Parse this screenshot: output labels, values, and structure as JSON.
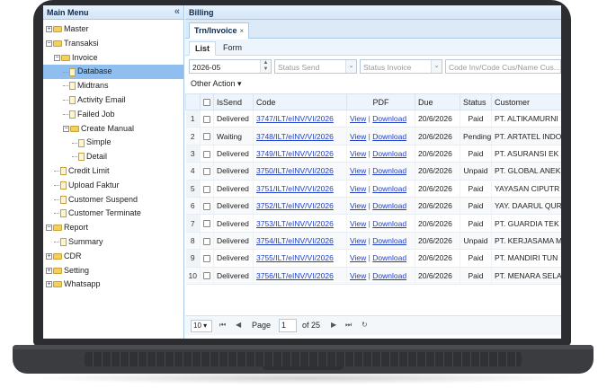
{
  "sidebar": {
    "title": "Main Menu",
    "collapse_icon": "«",
    "items": [
      {
        "label": "Master"
      },
      {
        "label": "Transaksi"
      },
      {
        "label": "Invoice"
      },
      {
        "label": "Database"
      },
      {
        "label": "Midtrans"
      },
      {
        "label": "Activity Email"
      },
      {
        "label": "Failed Job"
      },
      {
        "label": "Create Manual"
      },
      {
        "label": "Simple"
      },
      {
        "label": "Detail"
      },
      {
        "label": "Credit Limit"
      },
      {
        "label": "Upload Faktur"
      },
      {
        "label": "Customer Suspend"
      },
      {
        "label": "Customer Terminate"
      },
      {
        "label": "Report"
      },
      {
        "label": "Summary"
      },
      {
        "label": "CDR"
      },
      {
        "label": "Setting"
      },
      {
        "label": "Whatsapp"
      }
    ]
  },
  "main": {
    "title": "Billing",
    "tab_label": "Trn/Invoice",
    "tab_close": "×",
    "subtabs": [
      "List",
      "Form"
    ],
    "filters": {
      "period": "2026-05",
      "status_send_placeholder": "Status Send",
      "status_invoice_placeholder": "Status Invoice",
      "search_placeholder": "Code Inv/Code Cus/Name Cus..."
    },
    "other_action": "Other Action",
    "columns": [
      "IsSend",
      "Code",
      "PDF",
      "Due",
      "Status",
      "Customer"
    ],
    "pdf_view": "View",
    "pdf_download": "Download",
    "rows": [
      {
        "n": "1",
        "issend": "Delivered",
        "code": "3747/ILT/eINV/VI/2026",
        "due": "20/6/2026",
        "status": "Paid",
        "customer": "PT. ALTIKAMURNI"
      },
      {
        "n": "2",
        "issend": "Waiting",
        "code": "3748/ILT/eINV/VI/2026",
        "due": "20/6/2026",
        "status": "Pending",
        "customer": "PT. ARTATEL INDO"
      },
      {
        "n": "3",
        "issend": "Delivered",
        "code": "3749/ILT/eINV/VI/2026",
        "due": "20/6/2026",
        "status": "Paid",
        "customer": "PT. ASURANSI EK"
      },
      {
        "n": "4",
        "issend": "Delivered",
        "code": "3750/ILT/eINV/VI/2026",
        "due": "20/6/2026",
        "status": "Unpaid",
        "customer": "PT. GLOBAL ANEK"
      },
      {
        "n": "5",
        "issend": "Delivered",
        "code": "3751/ILT/eINV/VI/2026",
        "due": "20/6/2026",
        "status": "Paid",
        "customer": "YAYASAN CIPUTR"
      },
      {
        "n": "6",
        "issend": "Delivered",
        "code": "3752/ILT/eINV/VI/2026",
        "due": "20/6/2026",
        "status": "Paid",
        "customer": "YAY. DAARUL QUR"
      },
      {
        "n": "7",
        "issend": "Delivered",
        "code": "3753/ILT/eINV/VI/2026",
        "due": "20/6/2026",
        "status": "Paid",
        "customer": "PT. GUARDIA TEK"
      },
      {
        "n": "8",
        "issend": "Delivered",
        "code": "3754/ILT/eINV/VI/2026",
        "due": "20/6/2026",
        "status": "Unpaid",
        "customer": "PT. KERJASAMA M"
      },
      {
        "n": "9",
        "issend": "Delivered",
        "code": "3755/ILT/eINV/VI/2026",
        "due": "20/6/2026",
        "status": "Paid",
        "customer": "PT. MANDIRI TUN"
      },
      {
        "n": "10",
        "issend": "Delivered",
        "code": "3756/ILT/eINV/VI/2026",
        "due": "20/6/2026",
        "status": "Paid",
        "customer": "PT. MENARA SELA"
      }
    ],
    "pager": {
      "page_size": "10",
      "page_label": "Page",
      "current_page": "1",
      "of_label": "of 25"
    }
  }
}
